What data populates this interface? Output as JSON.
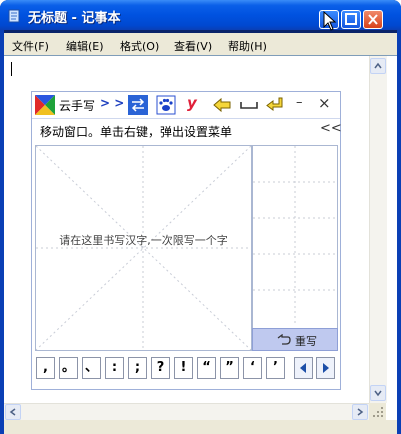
{
  "window": {
    "title": "无标题 - 记事本",
    "buttons": {
      "minimize": "minimize",
      "maximize": "maximize",
      "close": "close"
    }
  },
  "menubar": {
    "items": [
      {
        "label": "文件(F)"
      },
      {
        "label": "编辑(E)"
      },
      {
        "label": "格式(O)"
      },
      {
        "label": "查看(V)"
      },
      {
        "label": "帮助(H)"
      }
    ]
  },
  "editor": {
    "content": ""
  },
  "ime": {
    "brand": "云手写",
    "toolbar": {
      "expand_label": "> >",
      "y_label": "y",
      "minimize_label": "–",
      "close_label": "×"
    },
    "hint": "移动窗口。单击右键，弹出设置菜单",
    "collapse_label": "<<",
    "canvas_prompt": "请在这里书写汉字,一次限写一个字",
    "redo_label": "重写",
    "punctuation": [
      ",",
      "。",
      "、",
      ":",
      ";",
      "?",
      "!",
      "“",
      "”",
      "‘",
      "’"
    ]
  },
  "colors": {
    "titlebar": "#0052e0",
    "menubar": "#ece9d8",
    "ime_border": "#9fb0d9",
    "redo_bg": "#bfc9ef"
  }
}
